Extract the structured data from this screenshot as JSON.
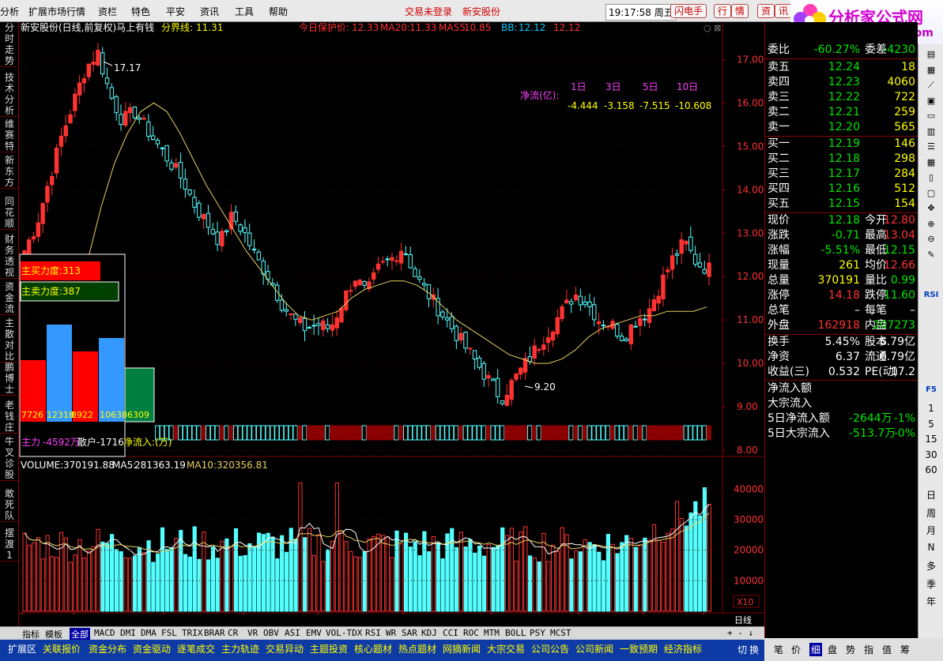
{
  "menu": {
    "items": [
      "分析",
      "扩展市场行情",
      "资栏",
      "特色",
      "平安",
      "资讯",
      "工具",
      "帮助"
    ],
    "status_text": "交易未登录",
    "stock_name": "新安股份",
    "clock": "19:17:58 周五",
    "buttons": [
      "闪电手",
      "行",
      "情",
      "资",
      "讯"
    ]
  },
  "logo": {
    "title": "分析家公式网",
    "url": "www.88gs.com"
  },
  "left_tabs": [
    "分时走势",
    "技术分析",
    "维赛特",
    "新东方",
    "同花顺",
    "财务透视",
    "资金流",
    "主散对比",
    "鹏博士",
    "老钱庄",
    "牛叉诊股",
    "敢死队",
    "摆渡1"
  ],
  "chart_header": {
    "title": "新安股份(日线,前复权)马上有钱",
    "boundary_label": "分界线:",
    "boundary_value": "11.31",
    "guard_label": "今日保护价:",
    "guard_value": "12.33",
    "ma20_label": "MA20:",
    "ma20_value": "11.33",
    "ma55_label": "MA55:",
    "ma55_value": "10.85",
    "bb_label": "BB:",
    "bb_value": "12.12",
    "bb_value2": "12.12"
  },
  "netflow": {
    "label": "净流(亿):",
    "periods": [
      "1日",
      "3日",
      "5日",
      "10日"
    ],
    "values": [
      "-4.444",
      "-3.158",
      "-7.515",
      "-10.608"
    ]
  },
  "price_annotations": {
    "high": "17.17",
    "low": "9.20"
  },
  "overlay_panel": {
    "buy_label": "主买力度:",
    "buy_value": "313",
    "sell_label": "主卖力度:",
    "sell_value": "387",
    "bar_values": [
      "7726",
      "12318",
      "8922",
      "10638",
      "6309"
    ],
    "main_label": "主力",
    "main_value": "-4592万",
    "retail_label": "散户",
    "retail_value": "-1716",
    "netin_label": "净流入:(万)"
  },
  "volume_header": {
    "volume_label": "VOLUME:",
    "volume_value": "370191.88",
    "ma5_label": "MA5:",
    "ma5_value": "281363.19",
    "ma10_label": "MA10:",
    "ma10_value": "320356.81"
  },
  "x_axis": {
    "labels": [
      "2013年",
      "8",
      "9",
      "10",
      "11",
      "12",
      "1",
      "2",
      "3",
      "1"
    ],
    "period": "日线"
  },
  "volume_axis": {
    "labels": [
      "40000",
      "30000",
      "20000",
      "10000"
    ],
    "unit": "X10"
  },
  "chart_data": {
    "type": "candlestick",
    "title": "新安股份(日线,前复权)",
    "ylim": [
      8.0,
      17.5
    ],
    "y_ticks": [
      "17.00",
      "16.00",
      "15.00",
      "14.00",
      "13.00",
      "12.00",
      "11.00",
      "10.00",
      "9.00",
      "8.00"
    ],
    "close_path": [
      12.6,
      13.2,
      14.2,
      15.2,
      16.0,
      16.8,
      17.17,
      16.2,
      15.6,
      15.8,
      15.4,
      15.0,
      14.6,
      14.2,
      13.6,
      13.2,
      12.8,
      13.4,
      13.0,
      12.4,
      12.0,
      11.4,
      11.0,
      10.8,
      10.9,
      10.8,
      11.4,
      12.0,
      11.6,
      12.2,
      12.4,
      12.7,
      12.0,
      11.6,
      11.2,
      10.8,
      10.4,
      10.0,
      9.6,
      9.2,
      9.6,
      10.0,
      10.4,
      10.8,
      11.2,
      11.6,
      11.4,
      11.0,
      10.9,
      10.6,
      11.0,
      11.2,
      11.8,
      12.4,
      12.8,
      12.3,
      12.18
    ],
    "ma_path": [
      null,
      null,
      null,
      null,
      11.2,
      12.4,
      13.6,
      14.6,
      15.3,
      15.8,
      16.0,
      15.8,
      15.3,
      14.7,
      14.1,
      13.6,
      13.1,
      12.6,
      12.2,
      11.8,
      11.4,
      11.1,
      11.0,
      11.1,
      11.2,
      11.5,
      11.7,
      11.8,
      11.9,
      11.9,
      11.8,
      11.6,
      11.3,
      11.0,
      10.8,
      10.6,
      10.4,
      10.2,
      10.1,
      10.0,
      10.0,
      10.1,
      10.3,
      10.6,
      10.8,
      10.9,
      11.0,
      11.1,
      11.1,
      11.2,
      11.2,
      11.2,
      11.3
    ]
  },
  "quote": {
    "wb_label": "委比",
    "wb_value": "-60.27%",
    "wc_label": "委差",
    "wc_value": "-4230",
    "asks": [
      {
        "label": "卖五",
        "price": "12.24",
        "vol": "18"
      },
      {
        "label": "卖四",
        "price": "12.23",
        "vol": "4060"
      },
      {
        "label": "卖三",
        "price": "12.22",
        "vol": "722"
      },
      {
        "label": "卖二",
        "price": "12.21",
        "vol": "259"
      },
      {
        "label": "卖一",
        "price": "12.20",
        "vol": "565"
      }
    ],
    "bids": [
      {
        "label": "买一",
        "price": "12.19",
        "vol": "146"
      },
      {
        "label": "买二",
        "price": "12.18",
        "vol": "298"
      },
      {
        "label": "买三",
        "price": "12.17",
        "vol": "284"
      },
      {
        "label": "买四",
        "price": "12.16",
        "vol": "512"
      },
      {
        "label": "买五",
        "price": "12.15",
        "vol": "154"
      }
    ],
    "stats": [
      {
        "l1": "现价",
        "v1": "12.18",
        "c1": "green",
        "l2": "今开",
        "v2": "12.80",
        "c2": "red"
      },
      {
        "l1": "涨跌",
        "v1": "-0.71",
        "c1": "green",
        "l2": "最高",
        "v2": "13.04",
        "c2": "red"
      },
      {
        "l1": "涨幅",
        "v1": "-5.51%",
        "c1": "green",
        "l2": "最低",
        "v2": "12.15",
        "c2": "green"
      },
      {
        "l1": "现量",
        "v1": "261",
        "c1": "yellow",
        "l2": "均价",
        "v2": "12.66",
        "c2": "red"
      },
      {
        "l1": "总量",
        "v1": "370191",
        "c1": "yellow",
        "l2": "量比",
        "v2": "0.99",
        "c2": "green"
      },
      {
        "l1": "涨停",
        "v1": "14.18",
        "c1": "red",
        "l2": "跌停",
        "v2": "11.60",
        "c2": "green"
      },
      {
        "l1": "总笔",
        "v1": "–",
        "c1": "white",
        "l2": "每笔",
        "v2": "–",
        "c2": "white"
      },
      {
        "l1": "外盘",
        "v1": "162918",
        "c1": "red",
        "l2": "内盘",
        "v2": "207273",
        "c2": "green"
      }
    ],
    "fund": [
      {
        "l1": "换手",
        "v1": "5.45%",
        "l2": "股本",
        "v2": "6.79亿"
      },
      {
        "l1": "净资",
        "v1": "6.37",
        "l2": "流通",
        "v2": "6.79亿"
      },
      {
        "l1": "收益(三)",
        "v1": "0.532",
        "l2": "PE(动)",
        "v2": "17.2"
      }
    ],
    "flows": {
      "netin_title": "净流入额",
      "block_title": "大宗流入",
      "row1_label": "5日净流入额",
      "row1_value": "-2644万",
      "row1_pct": "-1%",
      "row2_label": "5日大宗流入",
      "row2_value": "-513.7万",
      "row2_pct": "-0%"
    }
  },
  "icon_column": {
    "numbers": [
      "1",
      "5",
      "15",
      "30",
      "60"
    ],
    "periods": [
      "日",
      "周",
      "月",
      "N",
      "多",
      "季",
      "年"
    ],
    "codes": [
      "RSI",
      "F5"
    ]
  },
  "indicator_tabs": [
    "指标",
    "模板",
    "全部",
    "MACD",
    "DMI",
    "DMA",
    "FSL",
    "TRIX",
    "BRAR",
    "CR",
    "VR",
    "OBV",
    "ASI",
    "EMV",
    "VOL-TDX",
    "RSI",
    "WR",
    "SAR",
    "KDJ",
    "CCI",
    "ROC",
    "MTM",
    "BOLL",
    "PSY",
    "MCST"
  ],
  "bottom_tabs": [
    "扩展区",
    "关联报价",
    "资金分布",
    "资金驱动",
    "逐笔成交",
    "主力轨迹",
    "交易异动",
    "主题投资",
    "核心题材",
    "热点题材",
    "网摘新闻",
    "大宗交易",
    "公司公告",
    "公司新闻",
    "一致预期",
    "经济指标"
  ],
  "bottom_right": [
    "切",
    "换",
    "笔",
    "价",
    "细",
    "盘",
    "势",
    "指",
    "值",
    "筹"
  ]
}
